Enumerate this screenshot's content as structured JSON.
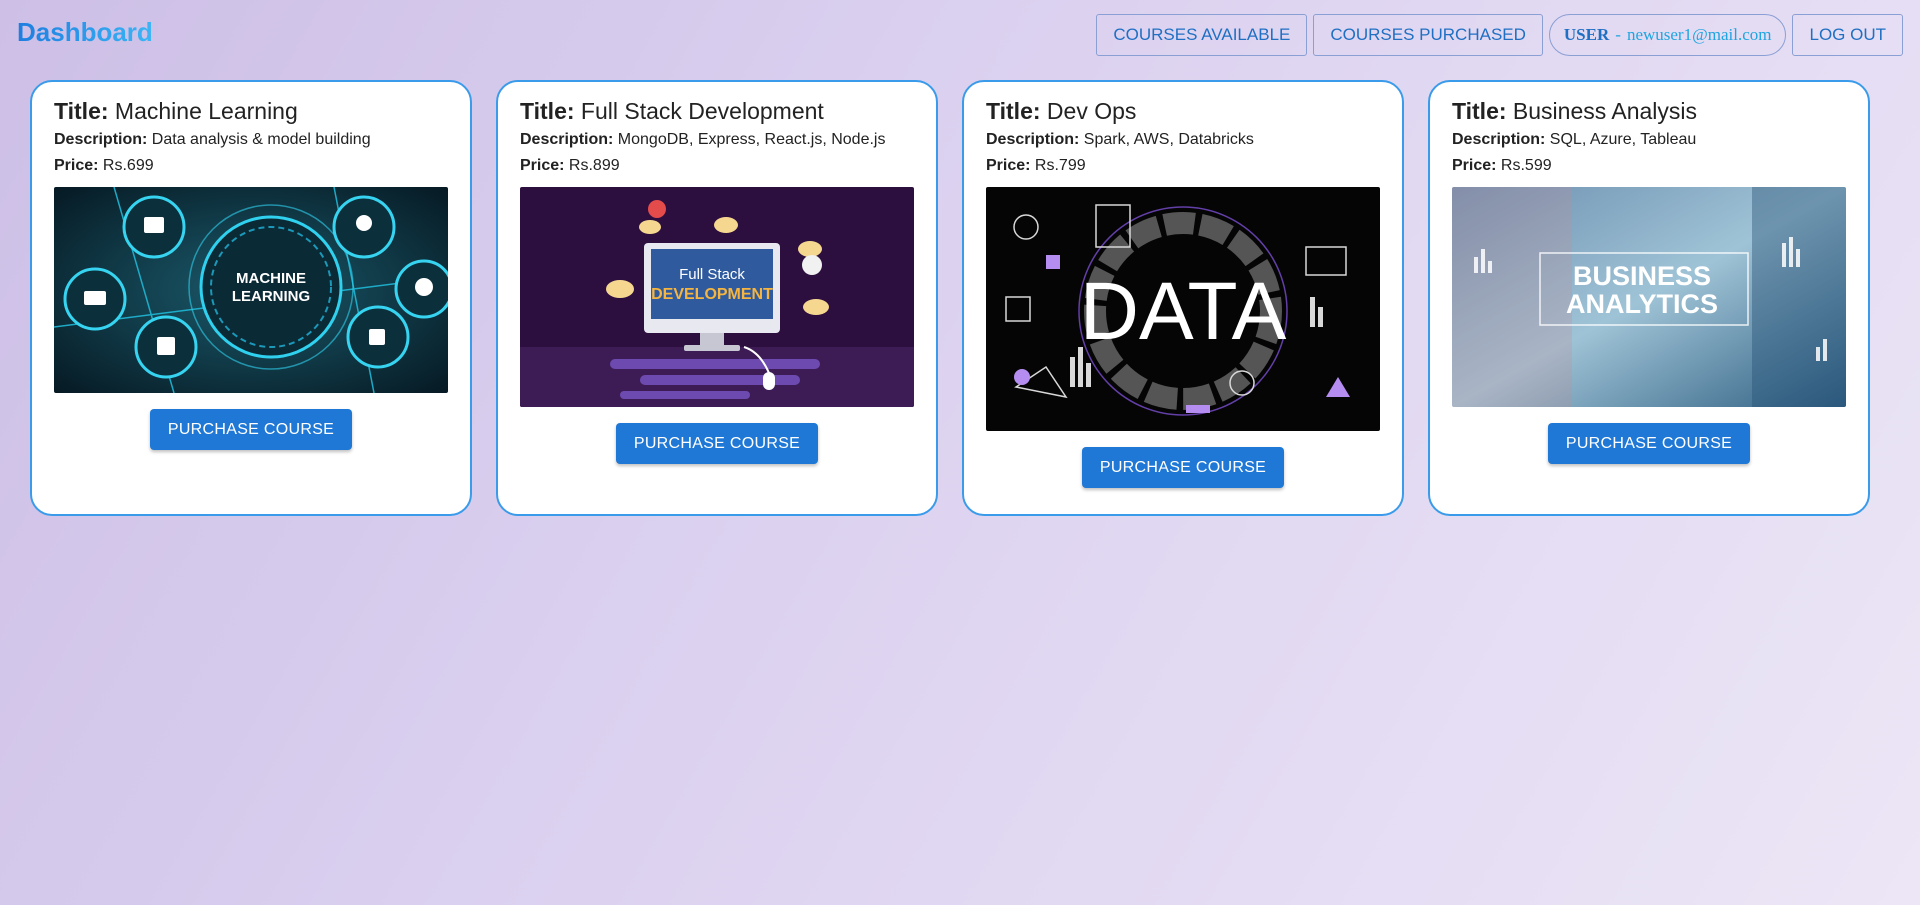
{
  "header": {
    "brand": "Dashboard",
    "nav": {
      "courses_available": "COURSES AVAILABLE",
      "courses_purchased": "COURSES PURCHASED",
      "user_label": "USER",
      "user_sep": "-",
      "user_email": "newuser1@mail.com",
      "logout": "LOG OUT"
    }
  },
  "labels": {
    "title": "Title:",
    "description": "Description:",
    "price": "Price:"
  },
  "courses": [
    {
      "title": "Machine Learning",
      "description": "Data analysis & model building",
      "price": "Rs.699",
      "image_text": [
        "MACHINE",
        "LEARNING"
      ],
      "button": "PURCHASE COURSE"
    },
    {
      "title": "Full Stack Development",
      "description": "MongoDB, Express, React.js, Node.js",
      "price": "Rs.899",
      "image_text": [
        "Full Stack",
        "DEVELOPMENT"
      ],
      "button": "PURCHASE COURSE"
    },
    {
      "title": "Dev Ops",
      "description": "Spark, AWS, Databricks",
      "price": "Rs.799",
      "image_text": [
        "DATA"
      ],
      "button": "PURCHASE COURSE"
    },
    {
      "title": "Business Analysis",
      "description": "SQL, Azure, Tableau",
      "price": "Rs.599",
      "image_text": [
        "BUSINESS",
        "ANALYTICS"
      ],
      "button": "PURCHASE COURSE"
    }
  ],
  "colors": {
    "accent": "#1f78d6",
    "card_border": "#3a9bea",
    "nav_text": "#1f6fc3"
  }
}
